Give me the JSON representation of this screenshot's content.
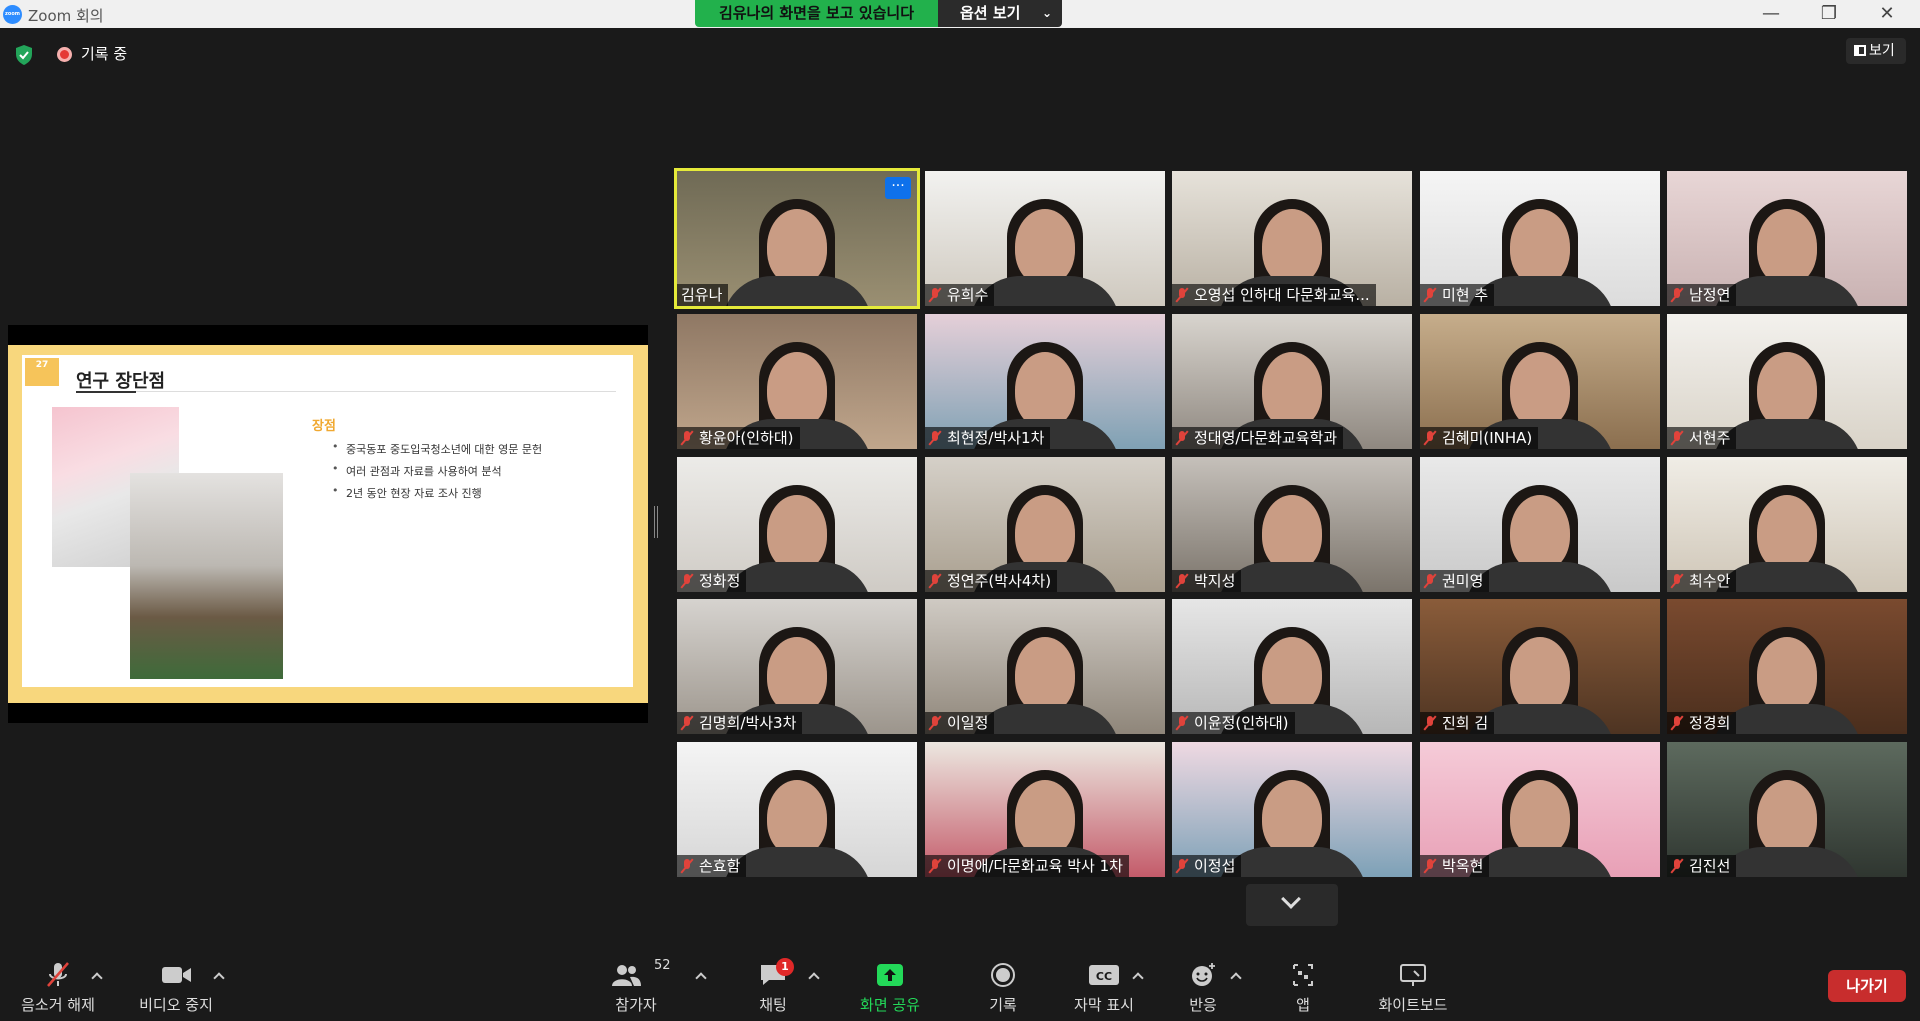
{
  "window": {
    "title": "Zoom 회의",
    "logo_text": "zoom",
    "minimize_glyph": "—",
    "restore_glyph": "❐",
    "close_glyph": "✕"
  },
  "share_banner": {
    "text": "김유나의 화면을 보고 있습니다",
    "options_label": "옵션 보기"
  },
  "status": {
    "recording_label": "기록 중",
    "view_label": "보기"
  },
  "slide": {
    "page_number": "27",
    "title": "연구 장단점",
    "heading": "장점",
    "bullets": [
      "중국동포 중도입국청소년에 대한 영문 문헌",
      "여러 관점과 자료를 사용하여 분석",
      "2년 동안 현장 자료 조사 진행"
    ]
  },
  "participants": [
    {
      "name": "김유나",
      "muted": false,
      "active": true,
      "more_label": "···"
    },
    {
      "name": "유희수",
      "muted": true
    },
    {
      "name": "오영섭 인하대 다문화교육...",
      "muted": true
    },
    {
      "name": "미현 추",
      "muted": true
    },
    {
      "name": "남정연",
      "muted": true
    },
    {
      "name": "황윤아(인하대)",
      "muted": true
    },
    {
      "name": "최현정/박사1차",
      "muted": true
    },
    {
      "name": "정대영/다문화교육학과",
      "muted": true
    },
    {
      "name": "김혜미(INHA)",
      "muted": true
    },
    {
      "name": "서현주",
      "muted": true
    },
    {
      "name": "정화정",
      "muted": true
    },
    {
      "name": "정연주(박사4차)",
      "muted": true
    },
    {
      "name": "박지성",
      "muted": true
    },
    {
      "name": "권미영",
      "muted": true
    },
    {
      "name": "최수안",
      "muted": true
    },
    {
      "name": "김명희/박사3차",
      "muted": true
    },
    {
      "name": "이일정",
      "muted": true
    },
    {
      "name": "이윤정(인하대)",
      "muted": true
    },
    {
      "name": "진희 김",
      "muted": true
    },
    {
      "name": "정경희",
      "muted": true
    },
    {
      "name": "손효함",
      "muted": true
    },
    {
      "name": "이명애/다문화교육 박사 1차",
      "muted": true
    },
    {
      "name": "이정섭",
      "muted": true
    },
    {
      "name": "박옥현",
      "muted": true
    },
    {
      "name": "김진선",
      "muted": true
    }
  ],
  "toolbar": {
    "unmute": "음소거 해제",
    "stop_video": "비디오 중지",
    "participants": "참가자",
    "participants_count": "52",
    "chat": "채팅",
    "chat_badge": "1",
    "share_screen": "화면 공유",
    "record": "기록",
    "captions": "자막 표시",
    "captions_icon_text": "CC",
    "reactions": "반응",
    "apps": "앱",
    "whiteboard": "화이트보드",
    "leave": "나가기"
  },
  "colors": {
    "share_banner_green": "#22b14c",
    "active_speaker_outline": "#e5ea3a",
    "mute_red": "#e0433b",
    "leave_red": "#c82d2d",
    "share_icon_green": "#23d959"
  }
}
